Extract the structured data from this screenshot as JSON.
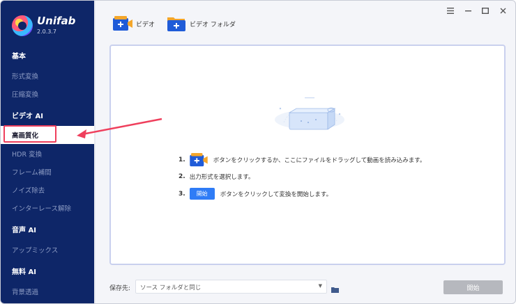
{
  "app": {
    "name": "Unifab",
    "version": "2.0.3.7"
  },
  "sidebar": {
    "sections": [
      {
        "title": "基本",
        "items": [
          "形式変換",
          "圧縮変換"
        ]
      },
      {
        "title": "ビデオ AI",
        "items": [
          "高画質化",
          "HDR 変換",
          "フレーム補間",
          "ノイズ除去",
          "インターレース解除"
        ]
      },
      {
        "title": "音声 AI",
        "items": [
          "アップミックス"
        ]
      },
      {
        "title": "無料 AI",
        "items": [
          "背景透過"
        ]
      }
    ],
    "active_item": "高画質化"
  },
  "toolbar": {
    "add_video_label": "ビデオ",
    "add_folder_label": "ビデオ フォルダ"
  },
  "instructions": {
    "step1_num": "1.",
    "step1_text": "ボタンをクリックするか、ここにファイルをドラッグして動画を読み込みます。",
    "step2_num": "2.",
    "step2_text": "出力形式を選択します。",
    "step3_num": "3.",
    "step3_button": "開始",
    "step3_text": "ボタンをクリックして変換を開始します。"
  },
  "footer": {
    "save_label": "保存先:",
    "save_value": "ソース フォルダと同じ",
    "start_label": "開始"
  },
  "colors": {
    "sidebar_bg": "#0e2668",
    "accent": "#2f7cf6",
    "highlight": "#ef3f5c"
  }
}
